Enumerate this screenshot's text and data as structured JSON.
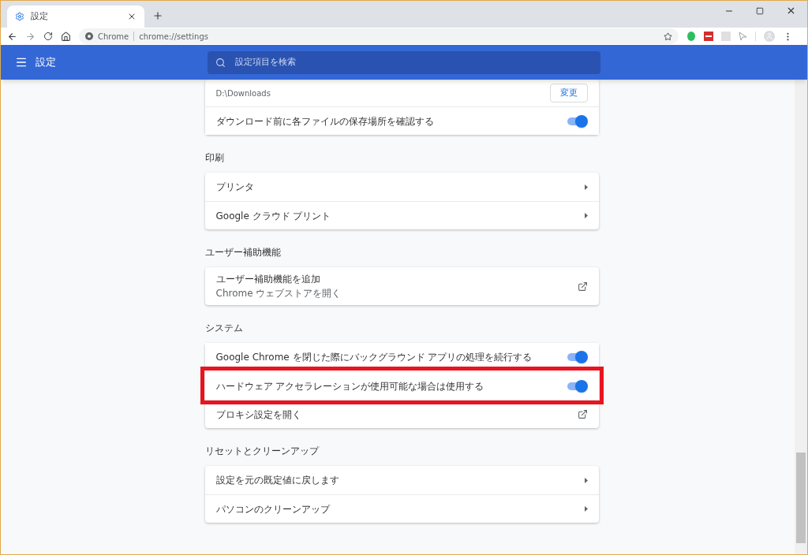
{
  "tab": {
    "title": "設定"
  },
  "address": {
    "site": "Chrome",
    "url": "chrome://settings"
  },
  "header": {
    "title": "設定",
    "search_placeholder": "設定項目を検索"
  },
  "sections": [
    {
      "items": [
        {
          "kind": "path",
          "label": "D:\\Downloads",
          "button": "変更"
        },
        {
          "kind": "toggle",
          "label": "ダウンロード前に各ファイルの保存場所を確認する",
          "on": true,
          "highlighted": false
        }
      ]
    },
    {
      "title": "印刷",
      "items": [
        {
          "kind": "link",
          "label": "プリンタ"
        },
        {
          "kind": "link",
          "label": "Google クラウド プリント"
        }
      ]
    },
    {
      "title": "ユーザー補助機能",
      "items": [
        {
          "kind": "external",
          "label": "ユーザー補助機能を追加",
          "sublabel": "Chrome ウェブストアを開く"
        }
      ]
    },
    {
      "title": "システム",
      "items": [
        {
          "kind": "toggle",
          "label": "Google Chrome を閉じた際にバックグラウンド アプリの処理を続行する",
          "on": true,
          "highlighted": false
        },
        {
          "kind": "toggle",
          "label": "ハードウェア アクセラレーションが使用可能な場合は使用する",
          "on": true,
          "highlighted": true
        },
        {
          "kind": "external",
          "label": "プロキシ設定を開く"
        }
      ]
    },
    {
      "title": "リセットとクリーンアップ",
      "items": [
        {
          "kind": "link",
          "label": "設定を元の既定値に戻します"
        },
        {
          "kind": "link",
          "label": "パソコンのクリーンアップ"
        }
      ]
    }
  ]
}
